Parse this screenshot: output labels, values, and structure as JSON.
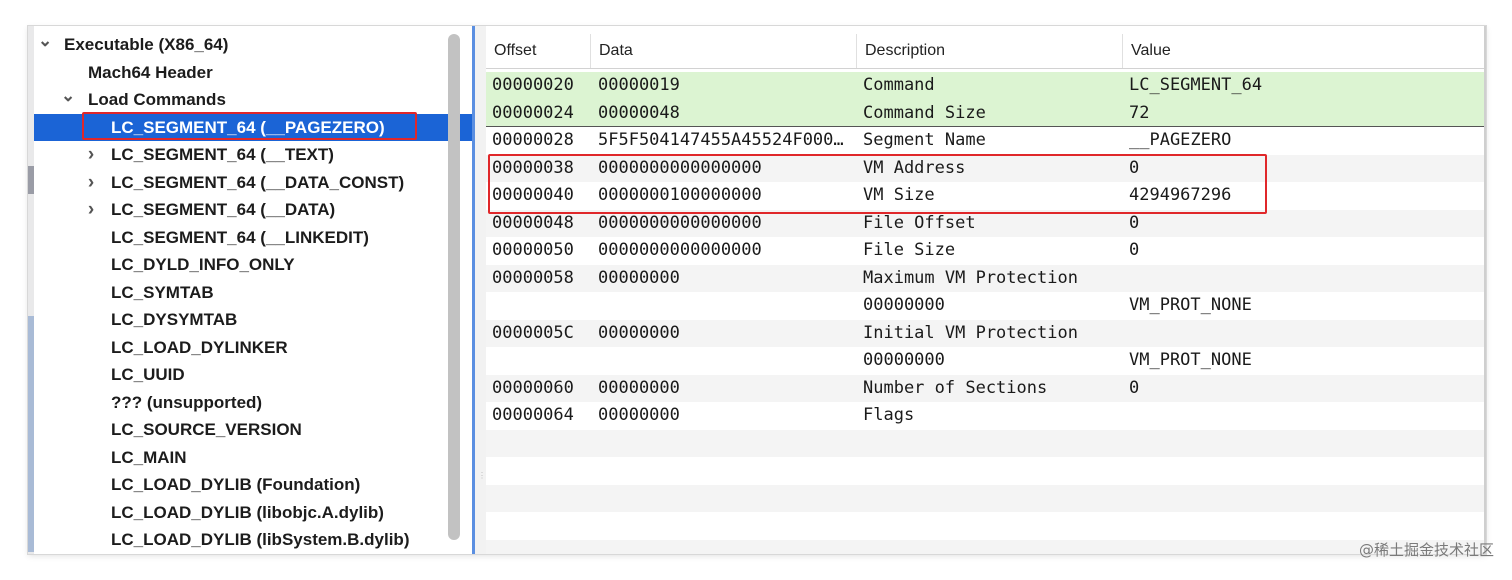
{
  "outline": {
    "items": [
      {
        "label": "Executable  (X86_64)",
        "level": 0,
        "disclosure": "expanded"
      },
      {
        "label": "Mach64 Header",
        "level": 1,
        "disclosure": "none"
      },
      {
        "label": "Load Commands",
        "level": 1,
        "disclosure": "expanded"
      },
      {
        "label": "LC_SEGMENT_64 (__PAGEZERO)",
        "level": 2,
        "disclosure": "none",
        "selected": true
      },
      {
        "label": "LC_SEGMENT_64 (__TEXT)",
        "level": 2,
        "disclosure": "collapsed"
      },
      {
        "label": "LC_SEGMENT_64 (__DATA_CONST)",
        "level": 2,
        "disclosure": "collapsed"
      },
      {
        "label": "LC_SEGMENT_64 (__DATA)",
        "level": 2,
        "disclosure": "collapsed"
      },
      {
        "label": "LC_SEGMENT_64 (__LINKEDIT)",
        "level": 2,
        "disclosure": "none"
      },
      {
        "label": "LC_DYLD_INFO_ONLY",
        "level": 2,
        "disclosure": "none"
      },
      {
        "label": "LC_SYMTAB",
        "level": 2,
        "disclosure": "none"
      },
      {
        "label": "LC_DYSYMTAB",
        "level": 2,
        "disclosure": "none"
      },
      {
        "label": "LC_LOAD_DYLINKER",
        "level": 2,
        "disclosure": "none"
      },
      {
        "label": "LC_UUID",
        "level": 2,
        "disclosure": "none"
      },
      {
        "label": "??? (unsupported)",
        "level": 2,
        "disclosure": "none"
      },
      {
        "label": "LC_SOURCE_VERSION",
        "level": 2,
        "disclosure": "none"
      },
      {
        "label": "LC_MAIN",
        "level": 2,
        "disclosure": "none"
      },
      {
        "label": "LC_LOAD_DYLIB (Foundation)",
        "level": 2,
        "disclosure": "none"
      },
      {
        "label": "LC_LOAD_DYLIB (libobjc.A.dylib)",
        "level": 2,
        "disclosure": "none"
      },
      {
        "label": "LC_LOAD_DYLIB (libSystem.B.dylib)",
        "level": 2,
        "disclosure": "none"
      }
    ]
  },
  "table": {
    "columns": [
      "Offset",
      "Data",
      "Description",
      "Value"
    ],
    "rows": [
      {
        "offset": "00000020",
        "data": "00000019",
        "description": "Command",
        "value": "LC_SEGMENT_64",
        "style": "highlight"
      },
      {
        "offset": "00000024",
        "data": "00000048",
        "description": "Command Size",
        "value": "72",
        "style": "highlight"
      },
      {
        "offset": "00000028",
        "data": "5F5F504147455A45524F000…",
        "description": "Segment Name",
        "value": "__PAGEZERO",
        "style": "plain"
      },
      {
        "offset": "00000038",
        "data": "0000000000000000",
        "description": "VM Address",
        "value": "0",
        "style": "alt"
      },
      {
        "offset": "00000040",
        "data": "0000000100000000",
        "description": "VM Size",
        "value": "4294967296",
        "style": "plain"
      },
      {
        "offset": "00000048",
        "data": "0000000000000000",
        "description": "File Offset",
        "value": "0",
        "style": "alt"
      },
      {
        "offset": "00000050",
        "data": "0000000000000000",
        "description": "File Size",
        "value": "0",
        "style": "plain"
      },
      {
        "offset": "00000058",
        "data": "00000000",
        "description": "Maximum VM Protection",
        "value": "",
        "style": "alt"
      },
      {
        "offset": "",
        "data": "",
        "description": "00000000",
        "value": "VM_PROT_NONE",
        "style": "plain"
      },
      {
        "offset": "0000005C",
        "data": "00000000",
        "description": "Initial VM Protection",
        "value": "",
        "style": "alt"
      },
      {
        "offset": "",
        "data": "",
        "description": "00000000",
        "value": "VM_PROT_NONE",
        "style": "plain"
      },
      {
        "offset": "00000060",
        "data": "00000000",
        "description": "Number of Sections",
        "value": "0",
        "style": "alt"
      },
      {
        "offset": "00000064",
        "data": "00000000",
        "description": "Flags",
        "value": "",
        "style": "plain"
      },
      {
        "offset": "",
        "data": "",
        "description": "",
        "value": "",
        "style": "alt"
      },
      {
        "offset": "",
        "data": "",
        "description": "",
        "value": "",
        "style": "plain"
      },
      {
        "offset": "",
        "data": "",
        "description": "",
        "value": "",
        "style": "alt"
      },
      {
        "offset": "",
        "data": "",
        "description": "",
        "value": "",
        "style": "plain"
      },
      {
        "offset": "",
        "data": "",
        "description": "",
        "value": "",
        "style": "alt"
      }
    ]
  },
  "watermark": "@稀土掘金技术社区",
  "colors": {
    "selection": "#1b64d6",
    "highlight_row": "#dcf4d2",
    "annotation_box": "#e0272a",
    "alt_row": "#f4f4f4"
  }
}
